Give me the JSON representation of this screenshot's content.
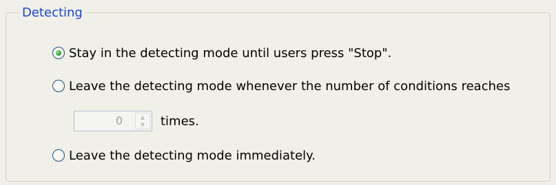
{
  "group": {
    "title": "Detecting"
  },
  "options": [
    {
      "label": "Stay in the detecting mode until users press \"Stop\".",
      "selected": true
    },
    {
      "label": "Leave the detecting mode whenever the number of conditions reaches",
      "selected": false
    },
    {
      "label": "Leave the detecting mode immediately.",
      "selected": false
    }
  ],
  "spinner": {
    "value": "0",
    "suffix": "times.",
    "enabled": false
  },
  "icons": {
    "radio_selected": "radio-selected-icon",
    "radio_unselected": "radio-unselected-icon",
    "spin_up": "chevron-up-icon",
    "spin_down": "chevron-down-icon"
  },
  "colors": {
    "title": "#1c44dc",
    "radio_dot": "#21a121",
    "background": "#f0f0e8"
  }
}
